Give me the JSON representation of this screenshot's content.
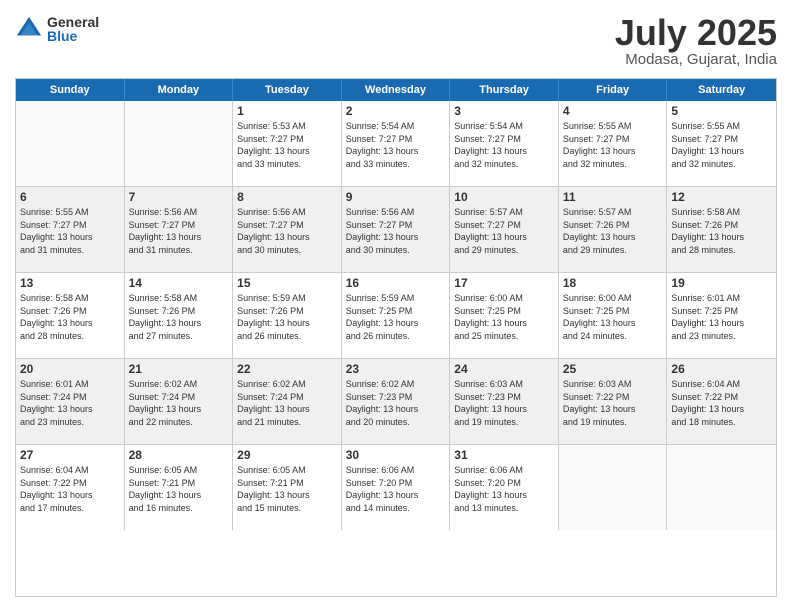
{
  "logo": {
    "general": "General",
    "blue": "Blue"
  },
  "title": {
    "month_year": "July 2025",
    "location": "Modasa, Gujarat, India"
  },
  "header_days": [
    "Sunday",
    "Monday",
    "Tuesday",
    "Wednesday",
    "Thursday",
    "Friday",
    "Saturday"
  ],
  "weeks": [
    [
      {
        "day": "",
        "lines": [],
        "empty": true
      },
      {
        "day": "",
        "lines": [],
        "empty": true
      },
      {
        "day": "1",
        "lines": [
          "Sunrise: 5:53 AM",
          "Sunset: 7:27 PM",
          "Daylight: 13 hours",
          "and 33 minutes."
        ]
      },
      {
        "day": "2",
        "lines": [
          "Sunrise: 5:54 AM",
          "Sunset: 7:27 PM",
          "Daylight: 13 hours",
          "and 33 minutes."
        ]
      },
      {
        "day": "3",
        "lines": [
          "Sunrise: 5:54 AM",
          "Sunset: 7:27 PM",
          "Daylight: 13 hours",
          "and 32 minutes."
        ]
      },
      {
        "day": "4",
        "lines": [
          "Sunrise: 5:55 AM",
          "Sunset: 7:27 PM",
          "Daylight: 13 hours",
          "and 32 minutes."
        ]
      },
      {
        "day": "5",
        "lines": [
          "Sunrise: 5:55 AM",
          "Sunset: 7:27 PM",
          "Daylight: 13 hours",
          "and 32 minutes."
        ]
      }
    ],
    [
      {
        "day": "6",
        "lines": [
          "Sunrise: 5:55 AM",
          "Sunset: 7:27 PM",
          "Daylight: 13 hours",
          "and 31 minutes."
        ]
      },
      {
        "day": "7",
        "lines": [
          "Sunrise: 5:56 AM",
          "Sunset: 7:27 PM",
          "Daylight: 13 hours",
          "and 31 minutes."
        ]
      },
      {
        "day": "8",
        "lines": [
          "Sunrise: 5:56 AM",
          "Sunset: 7:27 PM",
          "Daylight: 13 hours",
          "and 30 minutes."
        ]
      },
      {
        "day": "9",
        "lines": [
          "Sunrise: 5:56 AM",
          "Sunset: 7:27 PM",
          "Daylight: 13 hours",
          "and 30 minutes."
        ]
      },
      {
        "day": "10",
        "lines": [
          "Sunrise: 5:57 AM",
          "Sunset: 7:27 PM",
          "Daylight: 13 hours",
          "and 29 minutes."
        ]
      },
      {
        "day": "11",
        "lines": [
          "Sunrise: 5:57 AM",
          "Sunset: 7:26 PM",
          "Daylight: 13 hours",
          "and 29 minutes."
        ]
      },
      {
        "day": "12",
        "lines": [
          "Sunrise: 5:58 AM",
          "Sunset: 7:26 PM",
          "Daylight: 13 hours",
          "and 28 minutes."
        ]
      }
    ],
    [
      {
        "day": "13",
        "lines": [
          "Sunrise: 5:58 AM",
          "Sunset: 7:26 PM",
          "Daylight: 13 hours",
          "and 28 minutes."
        ]
      },
      {
        "day": "14",
        "lines": [
          "Sunrise: 5:58 AM",
          "Sunset: 7:26 PM",
          "Daylight: 13 hours",
          "and 27 minutes."
        ]
      },
      {
        "day": "15",
        "lines": [
          "Sunrise: 5:59 AM",
          "Sunset: 7:26 PM",
          "Daylight: 13 hours",
          "and 26 minutes."
        ]
      },
      {
        "day": "16",
        "lines": [
          "Sunrise: 5:59 AM",
          "Sunset: 7:25 PM",
          "Daylight: 13 hours",
          "and 26 minutes."
        ]
      },
      {
        "day": "17",
        "lines": [
          "Sunrise: 6:00 AM",
          "Sunset: 7:25 PM",
          "Daylight: 13 hours",
          "and 25 minutes."
        ]
      },
      {
        "day": "18",
        "lines": [
          "Sunrise: 6:00 AM",
          "Sunset: 7:25 PM",
          "Daylight: 13 hours",
          "and 24 minutes."
        ]
      },
      {
        "day": "19",
        "lines": [
          "Sunrise: 6:01 AM",
          "Sunset: 7:25 PM",
          "Daylight: 13 hours",
          "and 23 minutes."
        ]
      }
    ],
    [
      {
        "day": "20",
        "lines": [
          "Sunrise: 6:01 AM",
          "Sunset: 7:24 PM",
          "Daylight: 13 hours",
          "and 23 minutes."
        ]
      },
      {
        "day": "21",
        "lines": [
          "Sunrise: 6:02 AM",
          "Sunset: 7:24 PM",
          "Daylight: 13 hours",
          "and 22 minutes."
        ]
      },
      {
        "day": "22",
        "lines": [
          "Sunrise: 6:02 AM",
          "Sunset: 7:24 PM",
          "Daylight: 13 hours",
          "and 21 minutes."
        ]
      },
      {
        "day": "23",
        "lines": [
          "Sunrise: 6:02 AM",
          "Sunset: 7:23 PM",
          "Daylight: 13 hours",
          "and 20 minutes."
        ]
      },
      {
        "day": "24",
        "lines": [
          "Sunrise: 6:03 AM",
          "Sunset: 7:23 PM",
          "Daylight: 13 hours",
          "and 19 minutes."
        ]
      },
      {
        "day": "25",
        "lines": [
          "Sunrise: 6:03 AM",
          "Sunset: 7:22 PM",
          "Daylight: 13 hours",
          "and 19 minutes."
        ]
      },
      {
        "day": "26",
        "lines": [
          "Sunrise: 6:04 AM",
          "Sunset: 7:22 PM",
          "Daylight: 13 hours",
          "and 18 minutes."
        ]
      }
    ],
    [
      {
        "day": "27",
        "lines": [
          "Sunrise: 6:04 AM",
          "Sunset: 7:22 PM",
          "Daylight: 13 hours",
          "and 17 minutes."
        ]
      },
      {
        "day": "28",
        "lines": [
          "Sunrise: 6:05 AM",
          "Sunset: 7:21 PM",
          "Daylight: 13 hours",
          "and 16 minutes."
        ]
      },
      {
        "day": "29",
        "lines": [
          "Sunrise: 6:05 AM",
          "Sunset: 7:21 PM",
          "Daylight: 13 hours",
          "and 15 minutes."
        ]
      },
      {
        "day": "30",
        "lines": [
          "Sunrise: 6:06 AM",
          "Sunset: 7:20 PM",
          "Daylight: 13 hours",
          "and 14 minutes."
        ]
      },
      {
        "day": "31",
        "lines": [
          "Sunrise: 6:06 AM",
          "Sunset: 7:20 PM",
          "Daylight: 13 hours",
          "and 13 minutes."
        ]
      },
      {
        "day": "",
        "lines": [],
        "empty": true
      },
      {
        "day": "",
        "lines": [],
        "empty": true
      }
    ]
  ]
}
